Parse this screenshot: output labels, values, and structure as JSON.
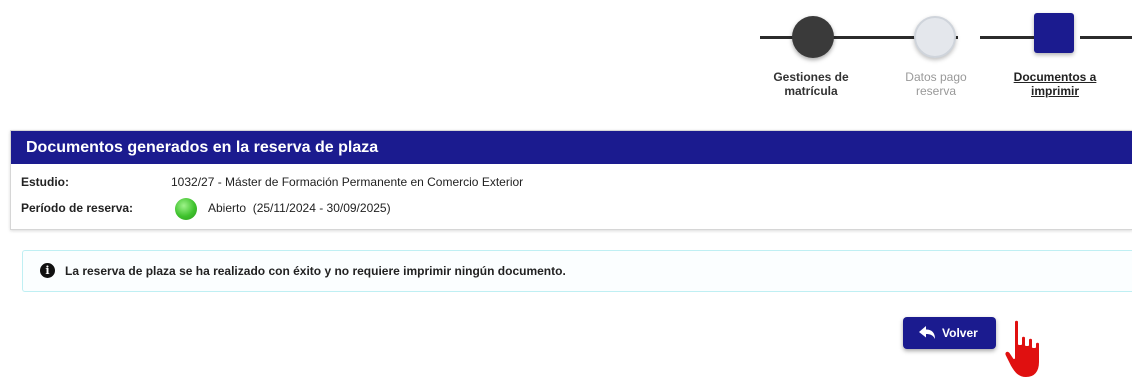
{
  "stepper": {
    "steps": [
      {
        "label_line1": "Gestiones de",
        "label_line2": "matrícula",
        "state": "completed"
      },
      {
        "label_line1": "Datos pago",
        "label_line2": "reserva",
        "state": "inactive"
      },
      {
        "label_line1": "Documentos a",
        "label_line2": "imprimir",
        "state": "current"
      }
    ]
  },
  "panel": {
    "title": "Documentos generados en la reserva de plaza",
    "estudio_label": "Estudio:",
    "estudio_value": "1032/27 - Máster de Formación Permanente en Comercio Exterior",
    "periodo_label": "Período de reserva:",
    "periodo_status": "Abierto",
    "periodo_dates": "(25/11/2024 - 30/09/2025)",
    "status_color": "#3fc22d"
  },
  "alert": {
    "icon": "info-circle-icon",
    "message": "La reserva de plaza se ha realizado con éxito y no requiere imprimir ningún documento."
  },
  "actions": {
    "volver_label": "Volver",
    "volver_icon": "undo-arrow-icon"
  },
  "colors": {
    "primary": "#1b1b8f",
    "alert_border": "#bfeff3",
    "cursor": "#e01010"
  }
}
